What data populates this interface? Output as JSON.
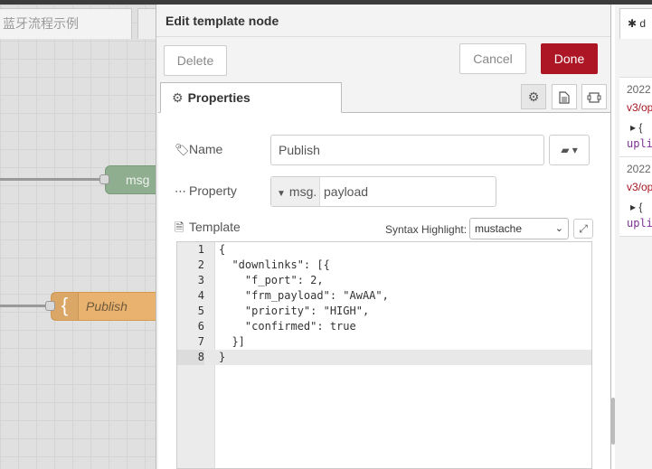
{
  "workspace": {
    "tab_label": "蓝牙流程示例",
    "msg_node_label": "msg",
    "template_node_label": "Publish",
    "template_node_icon": "{"
  },
  "tray": {
    "title": "Edit template node",
    "delete_label": "Delete",
    "cancel_label": "Cancel",
    "done_label": "Done",
    "tab_properties": "Properties",
    "fields": {
      "name_label": "Name",
      "name_value": "Publish",
      "property_label": "Property",
      "property_type": "msg.",
      "property_value": "payload",
      "template_label": "Template",
      "syntax_label": "Syntax Highlight:",
      "syntax_value": "mustache"
    },
    "code_lines": [
      {
        "n": "1",
        "t": "{"
      },
      {
        "n": "2",
        "t": "  \"downlinks\": [{"
      },
      {
        "n": "3",
        "t": "    \"f_port\": 2,"
      },
      {
        "n": "4",
        "t": "    \"frm_payload\": \"AwAA\","
      },
      {
        "n": "5",
        "t": "    \"priority\": \"HIGH\","
      },
      {
        "n": "6",
        "t": "    \"confirmed\": true"
      },
      {
        "n": "7",
        "t": "  }]"
      },
      {
        "n": "8",
        "t": "}"
      }
    ]
  },
  "sidebar": {
    "tab_label": "d",
    "messages": [
      {
        "date": "2022",
        "topic": "v3/op",
        "tree": "▸ {",
        "key": "upli"
      },
      {
        "date": "2022",
        "topic": "v3/op",
        "tree": "▸ {",
        "key": "upli"
      }
    ]
  },
  "colors": {
    "done_button": "#ad1625",
    "template_node": "#e9b26e",
    "msg_node": "#8fad8f",
    "topic_text": "#a7151f"
  }
}
